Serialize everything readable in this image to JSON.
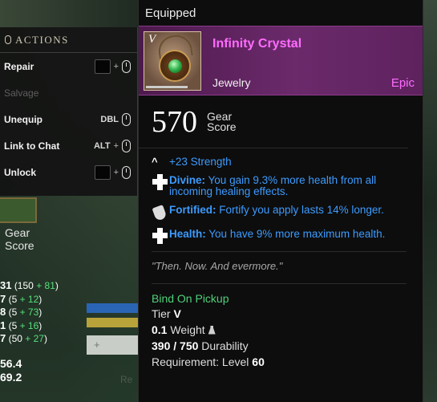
{
  "actions": {
    "title": "ACTIONS",
    "items": [
      {
        "label": "Repair",
        "hint": "",
        "plus": "+",
        "enabled": true
      },
      {
        "label": "Salvage",
        "hint": "",
        "plus": "",
        "enabled": false
      },
      {
        "label": "Unequip",
        "hint": "DBL",
        "plus": "",
        "enabled": true
      },
      {
        "label": "Link to Chat",
        "hint": "ALT",
        "plus": "+",
        "enabled": true
      },
      {
        "label": "Unlock",
        "hint": "",
        "plus": "+",
        "enabled": true
      }
    ]
  },
  "left_panel": {
    "gear_score_label": "Gear\nScore",
    "stats": [
      {
        "value": "31",
        "base": "(150",
        "bonus": "+ 81",
        "close": ")"
      },
      {
        "value": "7",
        "base": "(5",
        "bonus": "+ 12",
        "close": ")"
      },
      {
        "value": "8",
        "base": "(5",
        "bonus": "+ 73",
        "close": ")"
      },
      {
        "value": "1",
        "base": "(5",
        "bonus": "+ 16",
        "close": ")"
      },
      {
        "value": "7",
        "base": "(50",
        "bonus": "+ 27",
        "close": ")"
      }
    ],
    "totals": [
      "56.4",
      "69.2"
    ],
    "slot_button_label": "+",
    "ghost_text": "Re"
  },
  "tooltip": {
    "title": "Equipped",
    "item": {
      "name": "Infinity Crystal",
      "type": "Jewelry",
      "rarity": "Epic",
      "tier_mark": "V",
      "gear_score": "570",
      "gear_score_label_1": "Gear",
      "gear_score_label_2": "Score"
    },
    "attribute": {
      "text": "+23 Strength",
      "icon": "chevron-up-icon"
    },
    "perks": [
      {
        "name": "Divine:",
        "text": "You gain 9.3% more health from all incoming healing effects.",
        "icon": "plus-icon"
      },
      {
        "name": "Fortified:",
        "text": "Fortify you apply lasts 14% longer.",
        "icon": "shield-icon"
      },
      {
        "name": "Health:",
        "text": "You have 9% more maximum health.",
        "icon": "plus-icon"
      }
    ],
    "flavor": "\"Then. Now. And evermore.\"",
    "bind": "Bind On Pickup",
    "tier_label": "Tier",
    "tier_value": "V",
    "weight_value": "0.1",
    "weight_label": "Weight",
    "durability_value": "390 / 750",
    "durability_label": "Durability",
    "requirement_label": "Requirement: Level",
    "requirement_value": "60"
  },
  "colors": {
    "epic": "#ff6cff",
    "perk_blue": "#3c9bff",
    "green": "#4fd17a",
    "header_purple": "#6b2a6b"
  }
}
